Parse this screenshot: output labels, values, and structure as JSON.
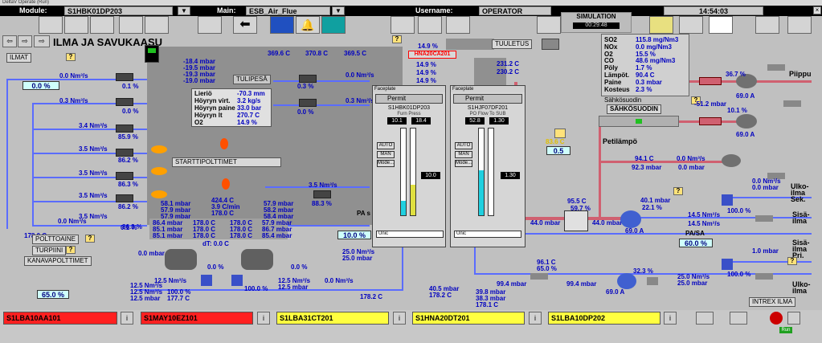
{
  "window": {
    "title": "DeltaV Operate (Run)"
  },
  "top": {
    "module_label": "Module:",
    "module": "S1HBK01DP203",
    "main_label": "Main:",
    "main": "ESB_Air_Flue",
    "user_label": "Username:",
    "user": "OPERATOR",
    "time": "14:54:03",
    "sim_title": "SIMULATION",
    "sim_time": "00:29:48"
  },
  "title": "ILMA JA SAVUKAASU",
  "labels": {
    "ilmat": "ILMAT",
    "tulipesa": "TULIPESÄ",
    "starttipolttimet": "STARTTIPOLTTIMET",
    "polttoaine": "POLTTOAINE",
    "turpiini": "TURPIINI",
    "kanavapolttimet": "KANAVAPOLTTIMET",
    "tuuletus": "TUULETUS",
    "hna": "HNA20CA201",
    "sahkosuodin": "SÄHKÖSUODIN",
    "sahkosuodin_small": "Sähkösuodin",
    "petilampo": "Petilämpö",
    "piippu": "Piippu",
    "ulkoilma_sek": "Ulko-\nilma\nSek.",
    "sisailma": "Sisä-\nilma",
    "pasa": "PA/SA",
    "sisailma_pri": "Sisä-\nilma\nPri.",
    "ulkoilma": "Ulko-\nilma",
    "intrex": "INTREX ILMA",
    "pa": "PA s"
  },
  "left_flows": {
    "f1": "0.0 Nm³/s",
    "f2": "0.3 Nm³/s",
    "f3": "3.4 Nm³/s",
    "f4": "3.5 Nm³/s",
    "f5": "3.5 Nm³/s",
    "f6": "3.5 Nm³/s",
    "f7": "3.5 Nm³/s",
    "v1": "0.1 %",
    "v2": "0.0 %",
    "v3": "85.9 %",
    "v4": "86.2 %",
    "v5": "86.3 %",
    "v6": "86.2 %",
    "v7": "86.3 %",
    "bottom_flow": "0.0 Nm³/s",
    "bottom_pct": "0.1 %",
    "box1": "0.0 %",
    "box_bottom": "65.0 %",
    "t178": "178.0 C"
  },
  "furnace": {
    "pressures": "-18.4 mbar\n-19.5 mbar\n-19.3 mbar\n-19.0 mbar",
    "info_labels": "Lieriö\nHöyryn virt.\nHöyryn paine\nHöyryn lt\nO2",
    "info_vals": "-70.3 mm\n3.2 kg/s\n33.0 bar\n270.7 C\n14.9 %",
    "t1": "369.6 C",
    "t2": "370.8 C",
    "t3": "369.5 C",
    "rflow1": "0.0 Nm³/s",
    "rflow2": "0.3 Nm³/s",
    "rv1": "0.3 %",
    "rv2": "0.0 %",
    "mid": "424.4 C\n3.9 C/min\n178.0 C",
    "low_left": "58.1 mbar\n57.9 mbar\n57.9 mbar",
    "low_right": "57.9 mbar\n58.2 mbar\n58.4 mbar",
    "bottom_vals": "86.4 mbar\n85.1 mbar\n85.1 mbar",
    "bottom_c": "178.0 C\n178.0 C\n178.0 C",
    "bottom_c2": "178.0 C\n178.0 C\n178.0 C",
    "bottom_right": "57.9 mbar\n86.7 mbar\n85.4 mbar",
    "dt": "dT: 0.0 C",
    "pa_flow": "3.5 Nm³/s",
    "pa_pct": "88.3 %",
    "pa_box": "10.0 %"
  },
  "stack": {
    "o2": "14.9 %",
    "o2b": "14.9 %",
    "o2c": "14.9 %",
    "o2d": "14.9 %",
    "t231": "231.2 C",
    "t230": "230.2 C"
  },
  "emissions": {
    "names": "SO2\nNOx\nO2\nCO\nPöly\nLämpöt.\nPaine\nKosteus",
    "values": "115.8 mg/Nm3\n0.0 mg/Nm3\n15.5 %\n48.6 mg/Nm3\n1.7 %\n90.4 C\n0.3 mbar\n2.3 %"
  },
  "right": {
    "f36": "36.7 %",
    "a69": "69.0 A",
    "t512": "-51.2 mbar",
    "v101": "10.1 %",
    "a69b": "69.0 A",
    "box05": "0.5",
    "x83": "83.6 C",
    "t941": "94.1 C",
    "p923": "92.3 mbar",
    "n00a": "0.0 Nm³/s",
    "p00a": "0.0 mbar",
    "p955": "95.5 C",
    "p597": "59.7 %",
    "p440": "44.0 mbar",
    "p440b": "44.0 mbar",
    "p401": "40.1 mbar",
    "p221": "22.1 %",
    "a690": "69.0 A",
    "f145a": "14.5 Nm³/s",
    "f145b": "14.5 Nm³/s",
    "pasa_box": "60.0 %",
    "sek00": "0.0 Nm³/s\n0.0 mbar",
    "v1000": "100.0 %",
    "pri": "1.0 mbar",
    "v1000b": "100.0 %",
    "c961": "96.1 C\n65.0 %",
    "p323": "32.3 %",
    "a690c": "69.0 A",
    "f250": "25.0 Nm³/s\n25.0 mbar",
    "m994": "99.4 mbar",
    "m994b": "99.4 mbar"
  },
  "bottom": {
    "a": "0.0 mbar",
    "b": "12.5 Nm³/s\n12.5 Nm³/s\n12.5 mbar",
    "c": "12.5 Nm³/s",
    "d": "100.0 %\n177.7 C",
    "e": "100.0 %",
    "f": "0.0 %",
    "g": "12.5 Nm³/s\n12.5 mbar",
    "h": "0.0 %",
    "i": "25.0 Nm³/s\n25.0 mbar",
    "j": "0.0 Nm³/s",
    "k": "178.2 C",
    "l": "40.5 mbar\n178.2 C",
    "m": "39.8 mbar\n38.3 mbar\n178.1 C"
  },
  "faceplate1": {
    "title": "Faceplate",
    "permit": "Permit",
    "tag": "S1HBK01DP203",
    "desc": "Furn Press",
    "v1": "10.1",
    "v2": "18.4",
    "auto": "AUTO",
    "man": "MAN",
    "mode": "Mode...",
    "out": "10.0",
    "input": "Unic"
  },
  "faceplate2": {
    "title": "Faceplate",
    "permit": "Permit",
    "tag": "S1HJF07DF201",
    "desc": "PO Flow To SUB",
    "v1": "52.8",
    "v2": "1.30",
    "auto": "AUTO",
    "man": "MAN",
    "mode": "Mode...",
    "out": "1.30",
    "input": "Unic"
  },
  "alarms": [
    {
      "tag": "S1LBA10AA101",
      "color": "#ff2020"
    },
    {
      "tag": "S1MAY10EZ101",
      "color": "#ff2020"
    },
    {
      "tag": "S1LBA31CT201",
      "color": "#ffff40"
    },
    {
      "tag": "S1HNA20DT201",
      "color": "#ffff40"
    },
    {
      "tag": "S1LBA10DP202",
      "color": "#ffff40"
    }
  ],
  "status": {
    "run": "Run"
  }
}
